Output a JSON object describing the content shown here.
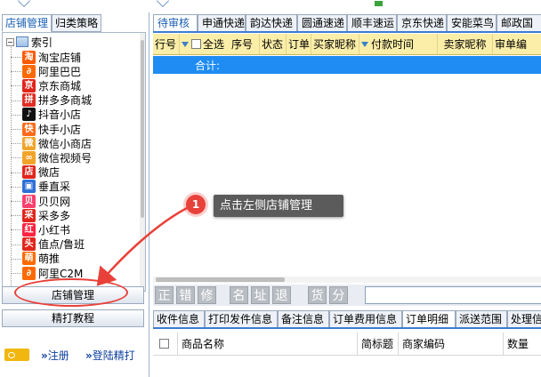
{
  "colors": {
    "accent": "#1e8cf2",
    "header_bg": "#fbeea8",
    "annotation_red": "#e8413a",
    "tooltip_bg": "#5b5b5b"
  },
  "left_panel": {
    "tabs": [
      "店铺管理",
      "归类策略"
    ],
    "tree_root": "索引",
    "stores": [
      {
        "label": "淘宝店铺",
        "icon": "taobao-icon",
        "glyph": "淘",
        "color": "#ff5a00"
      },
      {
        "label": "阿里巴巴",
        "icon": "alibaba-icon",
        "glyph": "∂",
        "color": "#ff6a00"
      },
      {
        "label": "京东商城",
        "icon": "jd-icon",
        "glyph": "京",
        "color": "#e1251b"
      },
      {
        "label": "拼多多商城",
        "icon": "pinduoduo-icon",
        "glyph": "拼",
        "color": "#e02e24"
      },
      {
        "label": "抖音小店",
        "icon": "douyin-icon",
        "glyph": "♪",
        "color": "#111111"
      },
      {
        "label": "快手小店",
        "icon": "kuaishou-icon",
        "glyph": "快",
        "color": "#ff6b1a"
      },
      {
        "label": "微信小商店",
        "icon": "wechat-shop-icon",
        "glyph": "微",
        "color": "#f2a42a"
      },
      {
        "label": "微信视频号",
        "icon": "wechat-channels-icon",
        "glyph": "∞",
        "color": "#f2a42a"
      },
      {
        "label": "微店",
        "icon": "weidian-icon",
        "glyph": "店",
        "color": "#e1251b"
      },
      {
        "label": "垂直采",
        "icon": "chuizhicai-icon",
        "glyph": "▣",
        "color": "#2e6fd8"
      },
      {
        "label": "贝贝网",
        "icon": "beibei-icon",
        "glyph": "贝",
        "color": "#ff3f6e"
      },
      {
        "label": "采多多",
        "icon": "caiduoduo-icon",
        "glyph": "采",
        "color": "#e1251b"
      },
      {
        "label": "小红书",
        "icon": "xiaohongshu-icon",
        "glyph": "红",
        "color": "#ff2442"
      },
      {
        "label": "值点/鲁班",
        "icon": "zhidian-icon",
        "glyph": "头",
        "color": "#e1251b"
      },
      {
        "label": "萌推",
        "icon": "mengtui-icon",
        "glyph": "萌",
        "color": "#ff6a00"
      },
      {
        "label": "阿里C2M",
        "icon": "ali-c2m-icon",
        "glyph": "∂",
        "color": "#ff6a00"
      }
    ],
    "btn_store_manage": "店铺管理",
    "btn_tutorial": "精打教程",
    "link_register": "注册",
    "link_login": "登陆精打",
    "link_arrow": "»"
  },
  "main": {
    "carrier_tabs": [
      "待审核",
      "申通快递",
      "韵达快递",
      "圆通速递",
      "顺丰速运",
      "京东快递",
      "安能菜鸟",
      "邮政国"
    ],
    "columns": [
      "行号",
      "全选",
      "序号",
      "状态",
      "订单",
      "买家昵称",
      "付款时间",
      "卖家昵称",
      "审单编"
    ],
    "total_label": "合计:",
    "toolbar_buttons": [
      "正",
      "错",
      "修",
      "名",
      "址",
      "退",
      "货",
      "分"
    ],
    "bottom_tabs": [
      "收件信息",
      "打印发件信息",
      "备注信息",
      "订单费用信息",
      "订单明细",
      "派送范围",
      "处理信"
    ],
    "detail_columns": [
      "商品名称",
      "简标题",
      "商家编码",
      "数量"
    ]
  },
  "annotation": {
    "step": "1",
    "text": "点击左侧店铺管理"
  }
}
